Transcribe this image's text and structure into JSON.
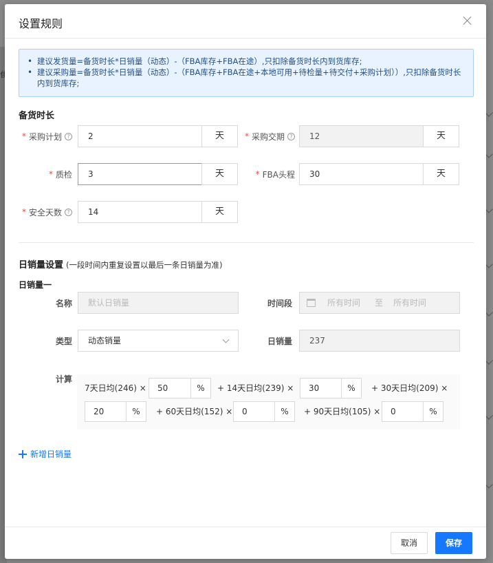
{
  "modal": {
    "title": "设置规则",
    "close_icon": "close-icon"
  },
  "info": {
    "lines": [
      "建议发货量=备货时长*日销量（动态）-（FBA库存+FBA在途）,只扣除备货时长内到货库存;",
      "建议采购量=备货时长*日销量（动态）-（FBA库存+FBA在途+本地可用+待检量+待交付+采购计划））,只扣除备货时长内到货库存;"
    ]
  },
  "stock": {
    "title": "备货时长",
    "unit": "天",
    "required_mark": "*",
    "fields": {
      "purchase_plan": {
        "label": "采购计划",
        "value": "2"
      },
      "purchase_lead": {
        "label": "采购交期",
        "value": "12"
      },
      "qc": {
        "label": "质检",
        "value": "3"
      },
      "fba_leg": {
        "label": "FBA头程",
        "value": "30"
      },
      "safety_days": {
        "label": "安全天数",
        "value": "14"
      }
    },
    "help_glyph": "?"
  },
  "sales": {
    "title": "日销量设置",
    "note": "(一段时间内重复设置以最后一条日销量为准)",
    "group_title": "日销量一",
    "name_label": "名称",
    "name_placeholder": "默认日销量",
    "period_label": "时间段",
    "period_start": "所有时间",
    "period_sep": "至",
    "period_end": "所有时间",
    "type_label": "类型",
    "type_value": "动态销量",
    "daily_label": "日销量",
    "daily_value": "237",
    "calc_label": "计算",
    "calc": {
      "t7": "7天日均(246) ×",
      "v7": "50",
      "t14": "+ 14天日均(239) ×",
      "v14": "30",
      "t30": "+ 30天日均(209) ×",
      "v30": "20",
      "t60": "+ 60天日均(152) ×",
      "v60": "0",
      "t90": "+ 90天日均(105) ×",
      "v90": "0",
      "pct": "%"
    }
  },
  "add_daily": "新增日销量",
  "footer": {
    "cancel": "取消",
    "save": "保存"
  },
  "background": {
    "side_text": "隹"
  }
}
